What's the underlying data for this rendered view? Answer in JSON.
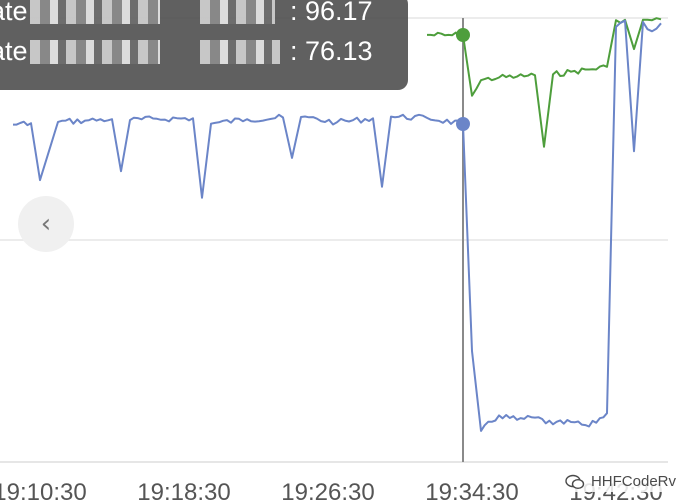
{
  "chart_data": {
    "type": "line",
    "xlabel": "",
    "ylabel": "",
    "x_tick_labels": [
      "19:10:30",
      "19:18:30",
      "19:26:30",
      "19:34:30",
      "19:42:30"
    ],
    "y_range": [
      0,
      100
    ],
    "grid": true,
    "hover_time": "19:34:00",
    "series": [
      {
        "color": "#4e9e3c",
        "x": [
          "19:32:00",
          "19:33:00",
          "19:34:00",
          "19:34:30",
          "19:35:00",
          "19:36:00",
          "19:37:00",
          "19:38:00",
          "19:38:30",
          "19:39:00",
          "19:40:00",
          "19:41:00",
          "19:42:00",
          "19:42:30",
          "19:43:00",
          "19:43:30",
          "19:44:00",
          "19:44:30",
          "19:45:00"
        ],
        "y": [
          96.2,
          96.1,
          96.17,
          82.5,
          86.0,
          86.6,
          86.8,
          87.1,
          71.0,
          87.3,
          87.9,
          88.4,
          89.0,
          99.5,
          99.6,
          93.0,
          99.6,
          99.5,
          99.7
        ]
      },
      {
        "color": "#6b85c8",
        "x": [
          "19:09:00",
          "19:10:00",
          "19:10:30",
          "19:11:30",
          "19:13:00",
          "19:14:30",
          "19:15:00",
          "19:15:30",
          "19:17:00",
          "19:19:00",
          "19:19:30",
          "19:20:00",
          "19:22:00",
          "19:24:00",
          "19:24:30",
          "19:25:00",
          "19:27:00",
          "19:29:00",
          "19:29:30",
          "19:30:00",
          "19:32:00",
          "19:34:00",
          "19:34:30",
          "19:35:00",
          "19:36:00",
          "19:37:00",
          "19:38:00",
          "19:39:00",
          "19:40:00",
          "19:41:00",
          "19:42:00",
          "19:42:30",
          "19:43:00",
          "19:43:30",
          "19:44:00",
          "19:44:30",
          "19:45:00"
        ],
        "y": [
          76.0,
          76.3,
          63.5,
          76.6,
          76.9,
          77.2,
          65.5,
          77.0,
          77.3,
          77.4,
          59.5,
          76.2,
          77.2,
          77.6,
          68.5,
          77.7,
          76.5,
          77.4,
          62.0,
          77.8,
          77.5,
          76.13,
          25.0,
          7.0,
          10.5,
          9.5,
          10.0,
          8.5,
          9.0,
          8.0,
          11.0,
          98.0,
          99.4,
          70.0,
          99.1,
          97.0,
          98.8
        ]
      }
    ]
  },
  "tooltip": {
    "rows": [
      {
        "name": "ate",
        "value": ": 96.17"
      },
      {
        "name": "ate",
        "value": ": 76.13"
      }
    ]
  },
  "nav": {
    "prev_glyph": "‹"
  },
  "watermark": {
    "text": "HHFCodeRv"
  }
}
